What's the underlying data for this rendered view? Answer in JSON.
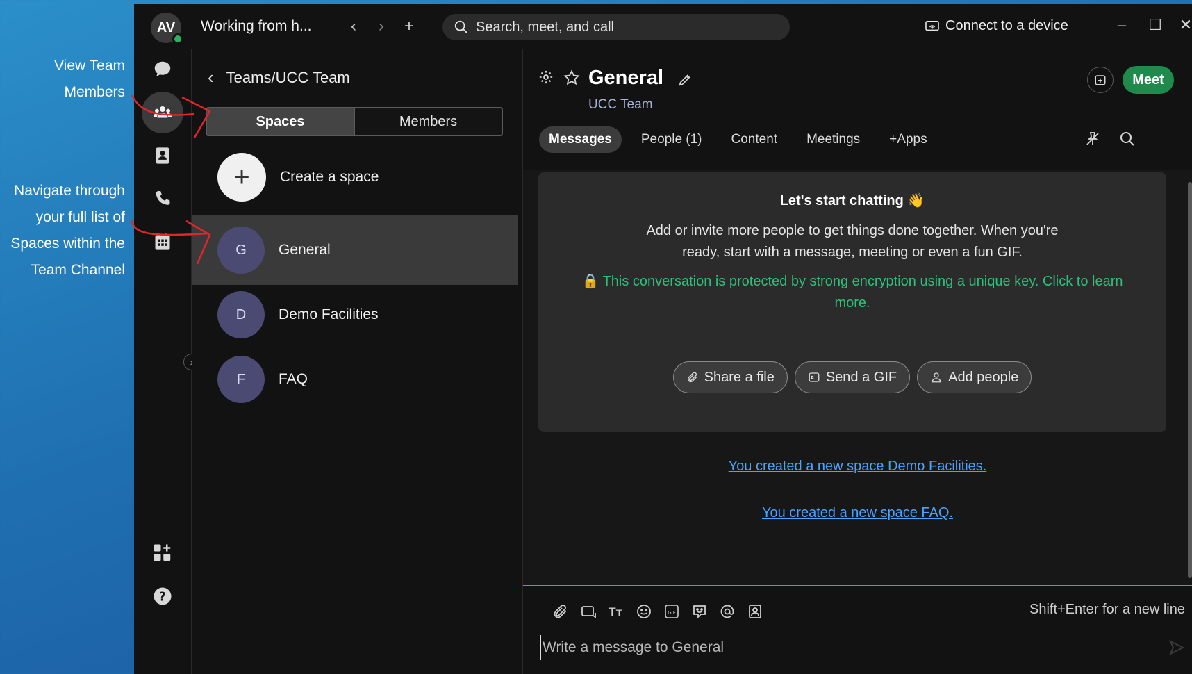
{
  "annotations": {
    "view_members_line1": "View Team",
    "view_members_line2": "Members",
    "navigate_line1": "Navigate through",
    "navigate_line2": "your full list of",
    "navigate_line3": "Spaces within the",
    "navigate_line4": "Team Channel",
    "arrow_color": "#e0262b"
  },
  "titlebar": {
    "avatar_initials": "AV",
    "status_text": "Working from h...",
    "search_placeholder": "Search, meet, and call",
    "connect_label": "Connect to a device"
  },
  "rail": {
    "items": [
      "chat-icon",
      "teams-icon",
      "contacts-icon",
      "calls-icon",
      "calendar-icon",
      "apps-icon",
      "help-icon"
    ],
    "active": "teams-icon"
  },
  "list": {
    "breadcrumb": "Teams/UCC Team",
    "seg_spaces": "Spaces",
    "seg_members": "Members",
    "create_label": "Create a space",
    "spaces": [
      {
        "initial": "G",
        "name": "General"
      },
      {
        "initial": "D",
        "name": "Demo Facilities"
      },
      {
        "initial": "F",
        "name": "FAQ"
      }
    ]
  },
  "main": {
    "title": "General",
    "subtitle": "UCC Team",
    "meet_label": "Meet",
    "tabs": [
      "Messages",
      "People (1)",
      "Content",
      "Meetings",
      "+Apps"
    ],
    "card_heading": "Let's start chatting 👋",
    "card_body": "Add or invite more people to get things done together. When you're ready, start with a message, meeting or even a fun GIF.",
    "encryption_notice": "🔒 This conversation is protected by strong encryption using a unique key. Click to learn more.",
    "actions": [
      "Share a file",
      "Send a GIF",
      "Add people"
    ],
    "system_messages": [
      "You created a new space Demo Facilities.",
      "You created a new space FAQ."
    ],
    "composer_hint": "Shift+Enter for a new line",
    "composer_placeholder": "Write a message to General"
  },
  "colors": {
    "accent_green": "#1f8a4c",
    "link_blue": "#4aa3ff",
    "encryption_green": "#2fbf7a",
    "avatar_purple": "#4b4a72"
  }
}
